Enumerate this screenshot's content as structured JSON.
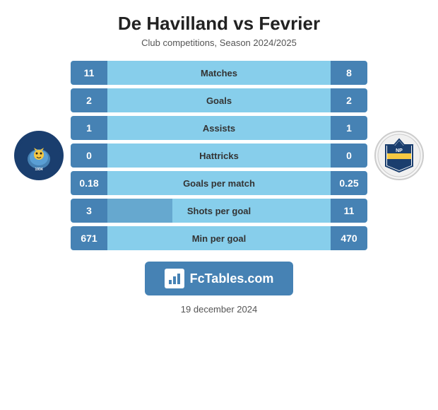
{
  "header": {
    "title": "De Havilland vs Fevrier",
    "subtitle": "Club competitions, Season 2024/2025"
  },
  "stats": [
    {
      "label": "Matches",
      "left": "11",
      "right": "8"
    },
    {
      "label": "Goals",
      "left": "2",
      "right": "2"
    },
    {
      "label": "Assists",
      "left": "1",
      "right": "1"
    },
    {
      "label": "Hattricks",
      "left": "0",
      "right": "0"
    },
    {
      "label": "Goals per match",
      "left": "0.18",
      "right": "0.25"
    },
    {
      "label": "Shots per goal",
      "left": "3",
      "right": "11",
      "shots": true
    },
    {
      "label": "Min per goal",
      "left": "671",
      "right": "470"
    }
  ],
  "banner": {
    "text": "FcTables.com"
  },
  "footer": {
    "date": "19 december 2024"
  }
}
